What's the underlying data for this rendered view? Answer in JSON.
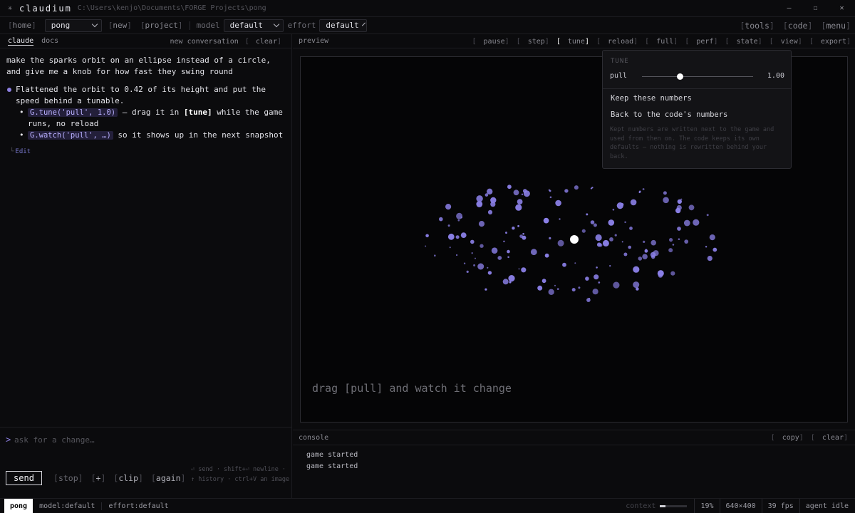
{
  "window": {
    "app_name": "claudium",
    "path": "C:\\Users\\kenjo\\Documents\\FORGE Projects\\pong",
    "controls": {
      "minimize": "–",
      "maximize": "☐",
      "close": "✕"
    }
  },
  "toolbar": {
    "home": "home",
    "project_select": "pong",
    "new": "new",
    "project": "project",
    "model_label": "model",
    "model_value": "default",
    "effort_label": "effort",
    "effort_value": "default",
    "tools": "tools",
    "code": "code",
    "menu": "menu"
  },
  "left": {
    "tabs": [
      {
        "label": "claude",
        "active": true
      },
      {
        "label": "docs",
        "active": false
      }
    ],
    "new_conversation": "new conversation",
    "clear": "clear",
    "user_message": "make the sparks orbit on an ellipse instead of a circle, and give me a knob for how fast they swing round",
    "reply": {
      "summary": "Flattened the orbit to 0.42 of its height and put the speed behind a tunable.",
      "bullet1_code": "G.tune('pull', 1.0)",
      "bullet1_pre": " — drag it in ",
      "bullet1_strong": "[tune]",
      "bullet1_post": " while the game runs, no reload",
      "bullet2_code": "G.watch('pull', …)",
      "bullet2_post": " so it shows up in the next snapshot"
    },
    "edit_link": "Edit",
    "prompt": {
      "caret": ">",
      "placeholder": "ask for a change…",
      "send": "send",
      "stop": "stop",
      "plus": "+",
      "clip": "clip",
      "again": "again",
      "hint": "⏎ send · shift+⏎ newline · ↑ history · ctrl+V an image"
    }
  },
  "preview": {
    "title": "preview",
    "controls": [
      {
        "label": "pause",
        "state": "normal"
      },
      {
        "label": "step",
        "state": "disabled"
      },
      {
        "label": "tune",
        "state": "active"
      },
      {
        "label": "reload",
        "state": "normal"
      },
      {
        "label": "full",
        "state": "normal"
      },
      {
        "label": "perf",
        "state": "normal"
      },
      {
        "label": "state",
        "state": "normal"
      },
      {
        "label": "view",
        "state": "normal"
      },
      {
        "label": "export",
        "state": "normal"
      }
    ],
    "game_message": "drag [pull] and watch it change",
    "colors": {
      "spark": "#8a7fe6",
      "core": "#ffffff"
    }
  },
  "tune": {
    "header": "TUNE",
    "param_name": "pull",
    "param_value": "1.00",
    "slider_fraction": 0.34,
    "keep": "Keep these numbers",
    "back": "Back to the code's numbers",
    "note": "Kept numbers are written next to the game and used from then on. The code keeps its own defaults — nothing is rewritten behind your back."
  },
  "console": {
    "title": "console",
    "copy": "copy",
    "clear": "clear",
    "lines": [
      "game started",
      "game started"
    ]
  },
  "status": {
    "project": "pong",
    "model": "model:default",
    "effort": "effort:default",
    "context_label": "context",
    "context_fraction": 0.19,
    "context_percent": "19%",
    "resolution": "640×400",
    "fps": "39 fps",
    "agent": "agent idle"
  }
}
